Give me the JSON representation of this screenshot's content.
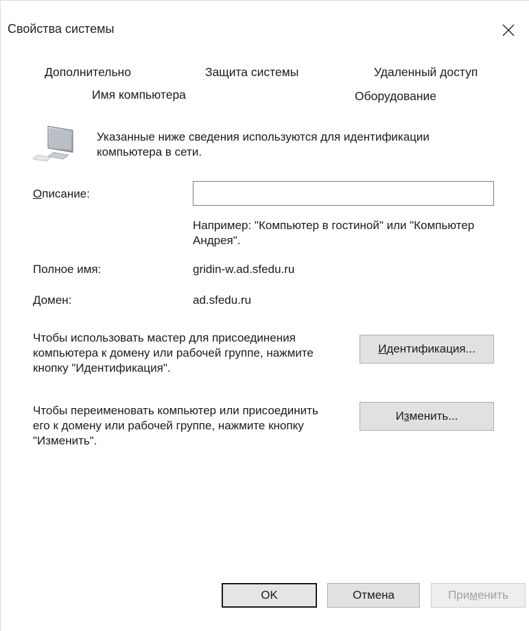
{
  "window": {
    "title": "Свойства системы"
  },
  "tabs": [
    {
      "label": "Дополнительно"
    },
    {
      "label": "Защита системы"
    },
    {
      "label": "Удаленный доступ"
    },
    {
      "label": "Имя компьютера"
    },
    {
      "label": "Оборудование"
    }
  ],
  "intro": {
    "text": "Указанные ниже сведения используются для идентификации компьютера в сети."
  },
  "description": {
    "label_accel": "О",
    "label_rest": "писание:",
    "value": "",
    "example": "Например: \"Компьютер в гостиной\" или \"Компьютер Андрея\"."
  },
  "full_name": {
    "label": "Полное имя:",
    "value": "gridin-w.ad.sfedu.ru"
  },
  "domain": {
    "label": "Домен:",
    "value": "ad.sfedu.ru"
  },
  "wizard": {
    "text": "Чтобы использовать мастер для присоединения компьютера к домену или рабочей группе, нажмите кнопку \"Идентификация\".",
    "button_accel": "И",
    "button_rest": "дентификация..."
  },
  "rename": {
    "text": "Чтобы переименовать компьютер или присоединить его к домену или рабочей группе, нажмите кнопку \"Изменить\".",
    "button_pre": "И",
    "button_accel": "з",
    "button_rest": "менить..."
  },
  "footer": {
    "ok_label": "OK",
    "cancel_label": "Отмена",
    "apply_pre": "При",
    "apply_accel": "м",
    "apply_rest": "енить"
  },
  "icons": {
    "close": "close-icon",
    "computer": "computer-icon"
  }
}
